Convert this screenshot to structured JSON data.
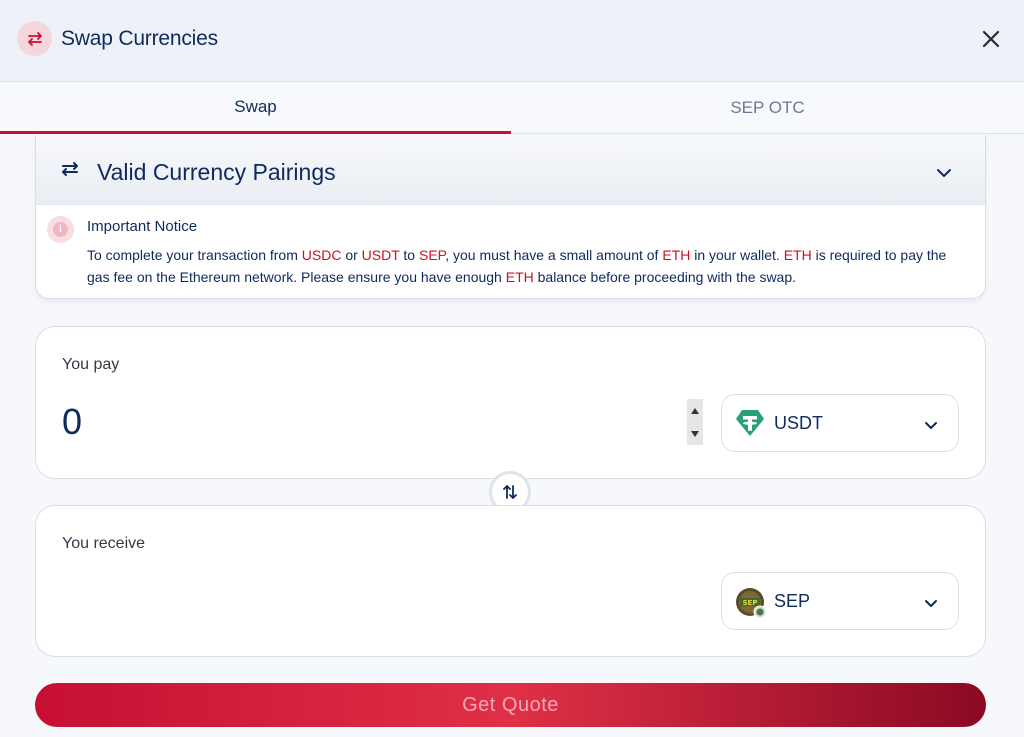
{
  "header": {
    "title": "Swap Currencies",
    "icon": "swap-arrows-icon",
    "close_icon": "close-icon"
  },
  "tabs": [
    {
      "label": "Swap",
      "active": true
    },
    {
      "label": "SEP OTC",
      "active": false
    }
  ],
  "pairings": {
    "title": "Valid Currency Pairings",
    "expanded": true,
    "notice": {
      "title": "Important Notice",
      "parts": [
        {
          "t": "To complete your transaction from ",
          "hl": false
        },
        {
          "t": "USDC",
          "hl": true
        },
        {
          "t": " or ",
          "hl": false
        },
        {
          "t": "USDT",
          "hl": true
        },
        {
          "t": " to ",
          "hl": false
        },
        {
          "t": "SEP",
          "hl": true
        },
        {
          "t": ", you must have a small amount of ",
          "hl": false
        },
        {
          "t": "ETH",
          "hl": true
        },
        {
          "t": " in your wallet. ",
          "hl": false
        },
        {
          "t": "ETH",
          "hl": true
        },
        {
          "t": " is required to pay the gas fee on the Ethereum network. Please ensure you have enough ",
          "hl": false
        },
        {
          "t": "ETH",
          "hl": true
        },
        {
          "t": " balance before proceeding with the swap.",
          "hl": false
        }
      ]
    }
  },
  "pay": {
    "label": "You pay",
    "amount": "0",
    "currency": "USDT",
    "currency_icon": "tether-icon"
  },
  "receive": {
    "label": "You receive",
    "amount": "",
    "currency": "SEP",
    "currency_icon": "sep-token-icon"
  },
  "actions": {
    "get_quote_label": "Get Quote",
    "get_quote_enabled": false
  },
  "colors": {
    "accent": "#c8102e",
    "text": "#0f2a5c",
    "tether": "#26a17b"
  }
}
